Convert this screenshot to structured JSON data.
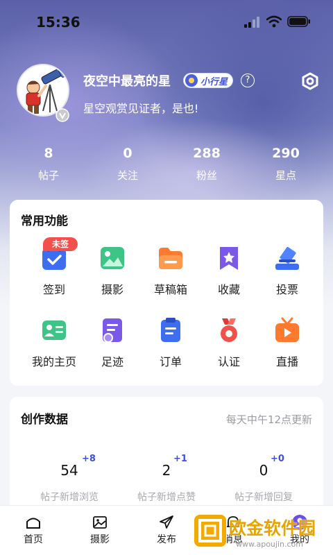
{
  "status_bar": {
    "time": "15:36"
  },
  "profile": {
    "name": "夜空中最亮的星",
    "level": "小行星",
    "help": "?",
    "bio": "星空观赏见证者，是也!"
  },
  "stats": [
    {
      "value": "8",
      "label": "帖子"
    },
    {
      "value": "0",
      "label": "关注"
    },
    {
      "value": "288",
      "label": "粉丝"
    },
    {
      "value": "290",
      "label": "星点"
    }
  ],
  "functions": {
    "title": "常用功能",
    "badge": "未签",
    "items": [
      {
        "label": "签到",
        "icon": "calendar-check-icon"
      },
      {
        "label": "摄影",
        "icon": "photo-icon"
      },
      {
        "label": "草稿箱",
        "icon": "folder-icon"
      },
      {
        "label": "收藏",
        "icon": "bookmark-icon"
      },
      {
        "label": "投票",
        "icon": "vote-icon"
      },
      {
        "label": "我的主页",
        "icon": "profile-card-icon"
      },
      {
        "label": "足迹",
        "icon": "footprint-icon"
      },
      {
        "label": "订单",
        "icon": "order-icon"
      },
      {
        "label": "认证",
        "icon": "medal-icon"
      },
      {
        "label": "直播",
        "icon": "live-tv-icon"
      }
    ]
  },
  "creation": {
    "title": "创作数据",
    "note": "每天中午12点更新",
    "metrics": [
      {
        "value": "54",
        "delta": "+8",
        "label": "帖子新增浏览"
      },
      {
        "value": "2",
        "delta": "+1",
        "label": "帖子新增点赞"
      },
      {
        "value": "0",
        "delta": "+0",
        "label": "帖子新增回复"
      }
    ]
  },
  "tabs": [
    {
      "label": "首页",
      "icon": "home-icon"
    },
    {
      "label": "摄影",
      "icon": "photo-icon"
    },
    {
      "label": "发布",
      "icon": "send-icon"
    },
    {
      "label": "消息",
      "icon": "bell-icon"
    },
    {
      "label": "我的",
      "icon": "user-icon"
    }
  ],
  "watermark": {
    "text": "欧金软件园",
    "url": "www.apoujin.com"
  },
  "colors": {
    "accent": "#3f4fd6",
    "badge_red": "#f2504b",
    "header_purple": "#5b60a8"
  }
}
